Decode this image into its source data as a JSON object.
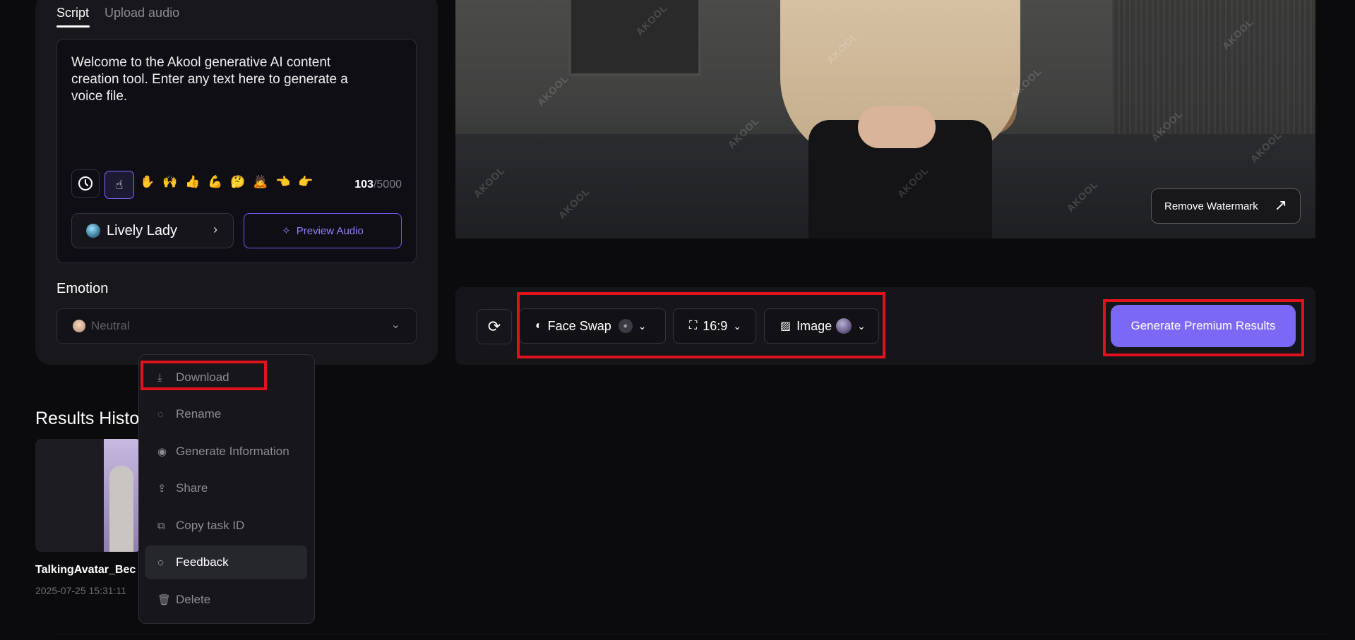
{
  "tabs": {
    "script": "Script",
    "upload": "Upload audio"
  },
  "script": {
    "text": "Welcome to the Akool generative AI content creation tool. Enter any text here to generate a voice file.",
    "count": "103",
    "max": "/5000"
  },
  "voice": {
    "name": "Lively Lady",
    "preview_label": "Preview Audio"
  },
  "emotion": {
    "title": "Emotion",
    "value": "Neutral"
  },
  "video": {
    "watermark": "AKOOL",
    "remove_watermark": "Remove Watermark"
  },
  "toolbar": {
    "face_swap": "Face Swap",
    "ratio": "16:9",
    "image": "Image",
    "generate": "Generate Premium Results"
  },
  "results": {
    "title": "Results Histo",
    "item_name": "TalkingAvatar_Bec",
    "item_date": "2025-07-25 15:31:11"
  },
  "context_menu": {
    "items": [
      {
        "label": "Download",
        "icon": "download-icon"
      },
      {
        "label": "Rename",
        "icon": "chat-icon"
      },
      {
        "label": "Generate Information",
        "icon": "eye-icon"
      },
      {
        "label": "Share",
        "icon": "share-icon"
      },
      {
        "label": "Copy task ID",
        "icon": "copy-icon"
      },
      {
        "label": "Feedback",
        "icon": "chat-icon"
      },
      {
        "label": "Delete",
        "icon": "trash-icon"
      }
    ]
  },
  "colors": {
    "accent": "#7b68f5",
    "highlight": "#e0121d",
    "background": "#0b0b0d"
  }
}
